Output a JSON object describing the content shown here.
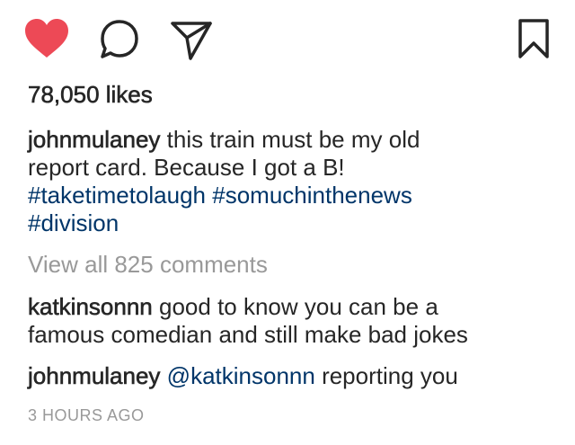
{
  "actions": {
    "like_icon": "heart-filled-icon",
    "comment_icon": "speech-bubble-icon",
    "share_icon": "paper-plane-icon",
    "save_icon": "bookmark-icon",
    "like_color": "#ed4956"
  },
  "likes": "78,050 likes",
  "caption": {
    "username": "johnmulaney",
    "text_line1": "this train must be my old",
    "text_line2": "report card. Because I got a B!",
    "hashtags_line1": "#taketimetolaugh #somuchinthenews",
    "hashtags_line2": "#division"
  },
  "view_all_comments": "View all 825 comments",
  "comments": [
    {
      "username": "katkinsonnn",
      "text_line1": "good to know you can be a",
      "text_line2": "famous comedian and still make bad jokes"
    },
    {
      "username": "johnmulaney",
      "mention": "@katkinsonnn",
      "text": "reporting you"
    }
  ],
  "timestamp": "3 HOURS AGO"
}
